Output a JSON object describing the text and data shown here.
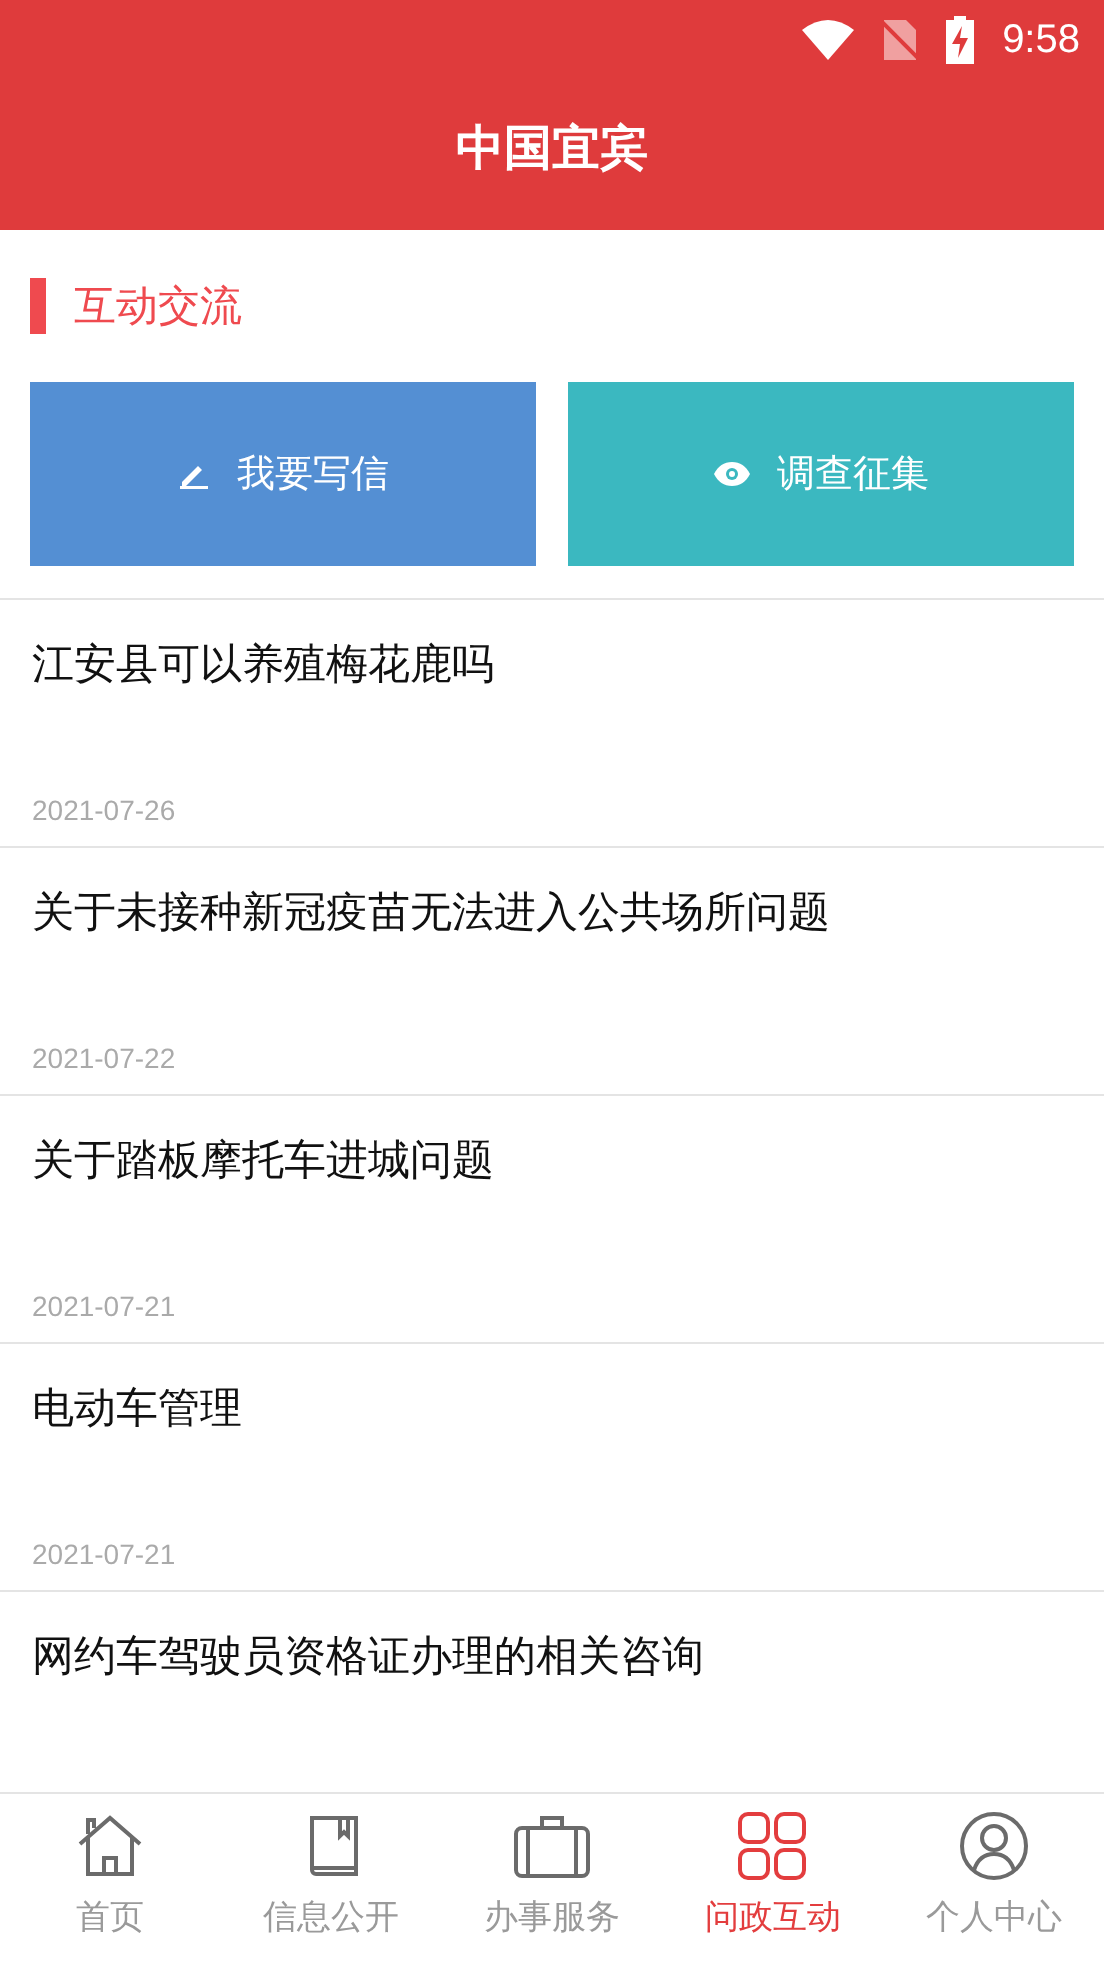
{
  "status_bar": {
    "time": "9:58"
  },
  "header": {
    "title": "中国宜宾"
  },
  "section": {
    "title": "互动交流"
  },
  "actions": [
    {
      "label": "我要写信",
      "color": "#548fd3"
    },
    {
      "label": "调查征集",
      "color": "#3bb8c0"
    }
  ],
  "posts": [
    {
      "title": "江安县可以养殖梅花鹿吗",
      "date": "2021-07-26"
    },
    {
      "title": "关于未接种新冠疫苗无法进入公共场所问题",
      "date": "2021-07-22"
    },
    {
      "title": "关于踏板摩托车进城问题",
      "date": "2021-07-21"
    },
    {
      "title": "电动车管理",
      "date": "2021-07-21"
    },
    {
      "title": "网约车驾驶员资格证办理的相关咨询"
    }
  ],
  "nav": [
    {
      "label": "首页",
      "selected": false
    },
    {
      "label": "信息公开",
      "selected": false
    },
    {
      "label": "办事服务",
      "selected": false
    },
    {
      "label": "问政互动",
      "selected": true
    },
    {
      "label": "个人中心",
      "selected": false
    }
  ]
}
